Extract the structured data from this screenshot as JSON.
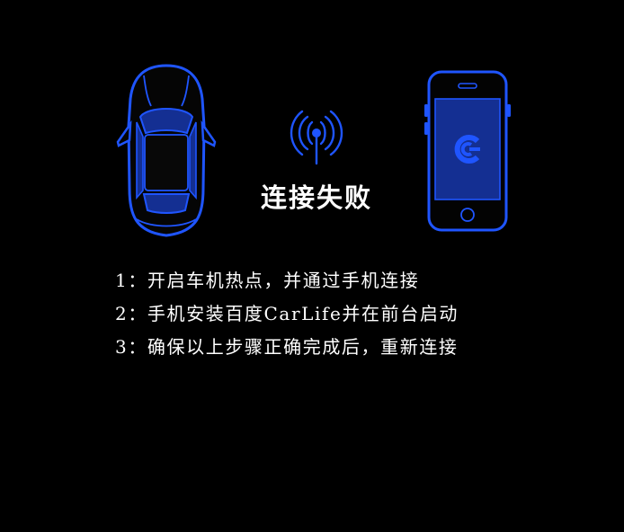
{
  "header": {
    "status_title": "连接失败"
  },
  "icons": {
    "car": "car-top-view-icon",
    "signal": "wifi-hotspot-icon",
    "phone": "phone-icon",
    "app": "carlife-logo-icon"
  },
  "steps": [
    "1：开启车机热点，并通过手机连接",
    "2：手机安装百度CarLife并在前台启动",
    "3：确保以上步骤正确完成后，重新连接"
  ],
  "colors": {
    "background": "#000000",
    "accent": "#1f55ff",
    "accent_fill": "#142f92",
    "text": "#ffffff"
  }
}
